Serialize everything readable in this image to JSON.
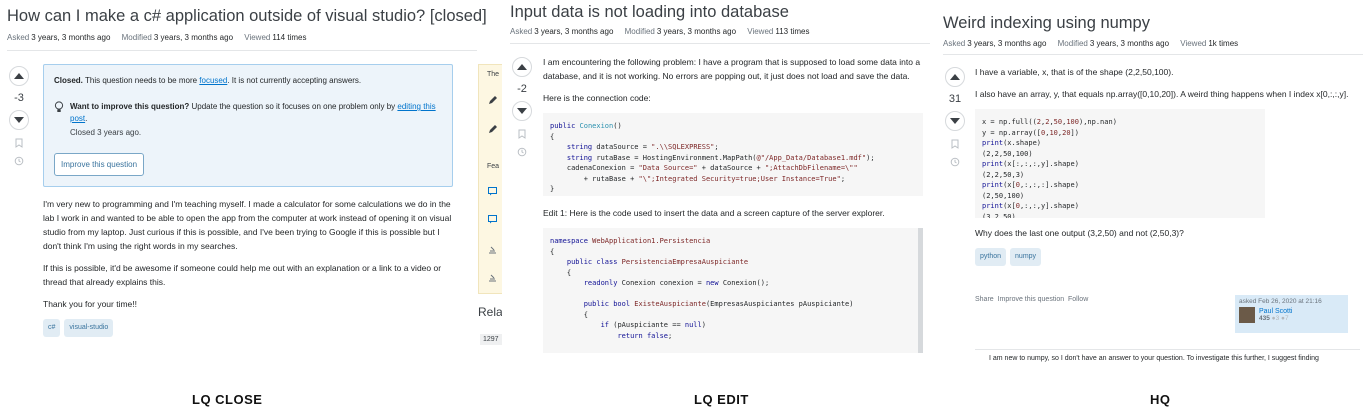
{
  "panel1": {
    "title": "How can I make a c# application outside of visual studio? [closed]",
    "meta": {
      "asked_k": "Asked",
      "asked_v": "3 years, 3 months ago",
      "modified_k": "Modified",
      "modified_v": "3 years, 3 months ago",
      "viewed_k": "Viewed",
      "viewed_v": "114 times"
    },
    "votes": "-3",
    "notice": {
      "closed_bold": "Closed.",
      "closed_text": " This question needs to be more ",
      "closed_link": "focused",
      "closed_end": ". It is not currently accepting answers.",
      "improve_bold": "Want to improve this question?",
      "improve_text": " Update the question so it focuses on one problem only by ",
      "improve_link": "editing this post",
      "improve_end": ".",
      "closed_when": "Closed 3 years ago.",
      "button": "Improve this question"
    },
    "body": [
      "I'm very new to programming and I'm teaching myself. I made a calculator for some calculations we do in the lab I work in and wanted to be able to open the app from the computer at work instead of opening it on visual studio from my laptop. Just curious if this is possible, and I've been trying to Google if this is possible but I don't think I'm using the right words in my searches.",
      "If this is possible, it'd be awesome if someone could help me out with an explanation or a link to a video or thread that already explains this.",
      "Thank you for your time!!"
    ],
    "tags": [
      "c#",
      "visual-studio"
    ],
    "sidebar": {
      "the": "The",
      "fea": "Fea",
      "rela": "Rela",
      "count": "1297"
    }
  },
  "panel2": {
    "title": "Input data is not loading into database",
    "meta": {
      "asked_k": "Asked",
      "asked_v": "3 years, 3 months ago",
      "modified_k": "Modified",
      "modified_v": "3 years, 3 months ago",
      "viewed_k": "Viewed",
      "viewed_v": "113 times"
    },
    "votes": "-2",
    "intro": "I am encountering the following problem: I have a program that is supposed to load some data into a database, and it is not working. No errors are popping out, it just does not load and save the data.",
    "conn_label": "Here is the connection code:",
    "edit_label": "Edit 1: Here is the code used to insert the data and a screen capture of the server explorer."
  },
  "panel3": {
    "title": "Weird indexing using numpy",
    "meta": {
      "asked_k": "Asked",
      "asked_v": "3 years, 3 months ago",
      "modified_k": "Modified",
      "modified_v": "3 years, 3 months ago",
      "viewed_k": "Viewed",
      "viewed_v": "1k times"
    },
    "votes": "31",
    "p1": "I have a variable, x, that is of the shape (2,2,50,100).",
    "p2": "I also have an array, y, that equals np.array([0,10,20]). A weird thing happens when I index x[0,:,:,y].",
    "question": "Why does the last one output (3,2,50) and not (2,50,3)?",
    "tags": [
      "python",
      "numpy"
    ],
    "actions": {
      "share": "Share",
      "improve": "Improve this question",
      "follow": "Follow"
    },
    "sig": {
      "asked": "asked Feb 26, 2020 at 21:16",
      "name": "Paul Scotti",
      "rep": "435",
      "badges": "●3 ●7"
    },
    "answer_snippet": "I am new to numpy, so I don't have an answer to your question. To investigate this further, I suggest finding"
  },
  "captions": {
    "c1": "LQ  CLOSE",
    "c2": "LQ  EDIT",
    "c3": "HQ"
  }
}
